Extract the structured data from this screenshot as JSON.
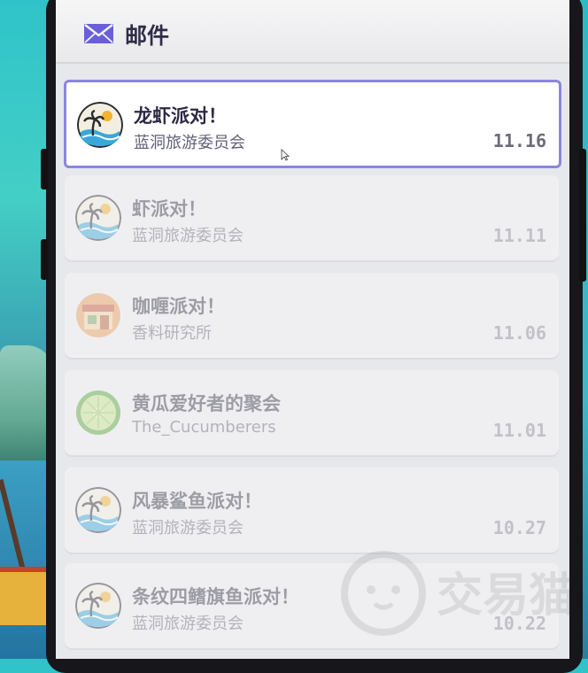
{
  "header": {
    "title": "邮件",
    "icon": "mail-icon"
  },
  "colors": {
    "accent": "#8b86e0",
    "mail_icon": "#6a5fd6"
  },
  "mails": [
    {
      "title": "龙虾派对！",
      "sender": "蓝洞旅游委员会",
      "date": "11.16",
      "avatar": "beach-icon",
      "selected": true
    },
    {
      "title": "虾派对！",
      "sender": "蓝洞旅游委员会",
      "date": "11.11",
      "avatar": "beach-icon",
      "selected": false
    },
    {
      "title": "咖喱派对！",
      "sender": "香料研究所",
      "date": "11.06",
      "avatar": "shop-icon",
      "selected": false
    },
    {
      "title": "黄瓜爱好者的聚会",
      "sender": "The_Cucumberers",
      "date": "11.01",
      "avatar": "cucumber-icon",
      "selected": false
    },
    {
      "title": "风暴鲨鱼派对！",
      "sender": "蓝洞旅游委员会",
      "date": "10.27",
      "avatar": "beach-icon",
      "selected": false
    },
    {
      "title": "条纹四鳍旗鱼派对！",
      "sender": "蓝洞旅游委员会",
      "date": "10.22",
      "avatar": "beach-icon",
      "selected": false
    }
  ],
  "watermark": "交易猫"
}
